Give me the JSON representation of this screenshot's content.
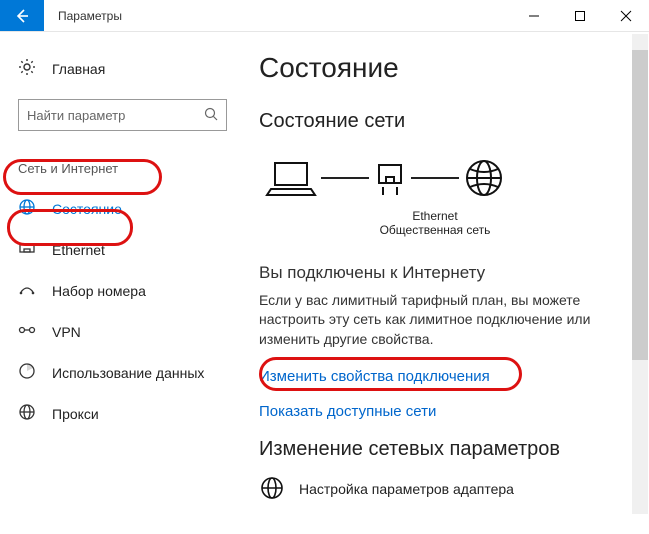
{
  "titlebar": {
    "title": "Параметры"
  },
  "sidebar": {
    "home": "Главная",
    "search_placeholder": "Найти параметр",
    "category": "Сеть и Интернет",
    "items": [
      {
        "label": "Состояние"
      },
      {
        "label": "Ethernet"
      },
      {
        "label": "Набор номера"
      },
      {
        "label": "VPN"
      },
      {
        "label": "Использование данных"
      },
      {
        "label": "Прокси"
      }
    ]
  },
  "main": {
    "h1": "Состояние",
    "h2": "Состояние сети",
    "diagram": {
      "label": "Ethernet",
      "sublabel": "Общественная сеть"
    },
    "conn_title": "Вы подключены к Интернету",
    "conn_body": "Если у вас лимитный тарифный план, вы можете настроить эту сеть как лимитное подключение или изменить другие свойства.",
    "link1": "Изменить свойства подключения",
    "link2": "Показать доступные сети",
    "h3": "Изменение сетевых параметров",
    "adapter": "Настройка параметров адаптера"
  }
}
